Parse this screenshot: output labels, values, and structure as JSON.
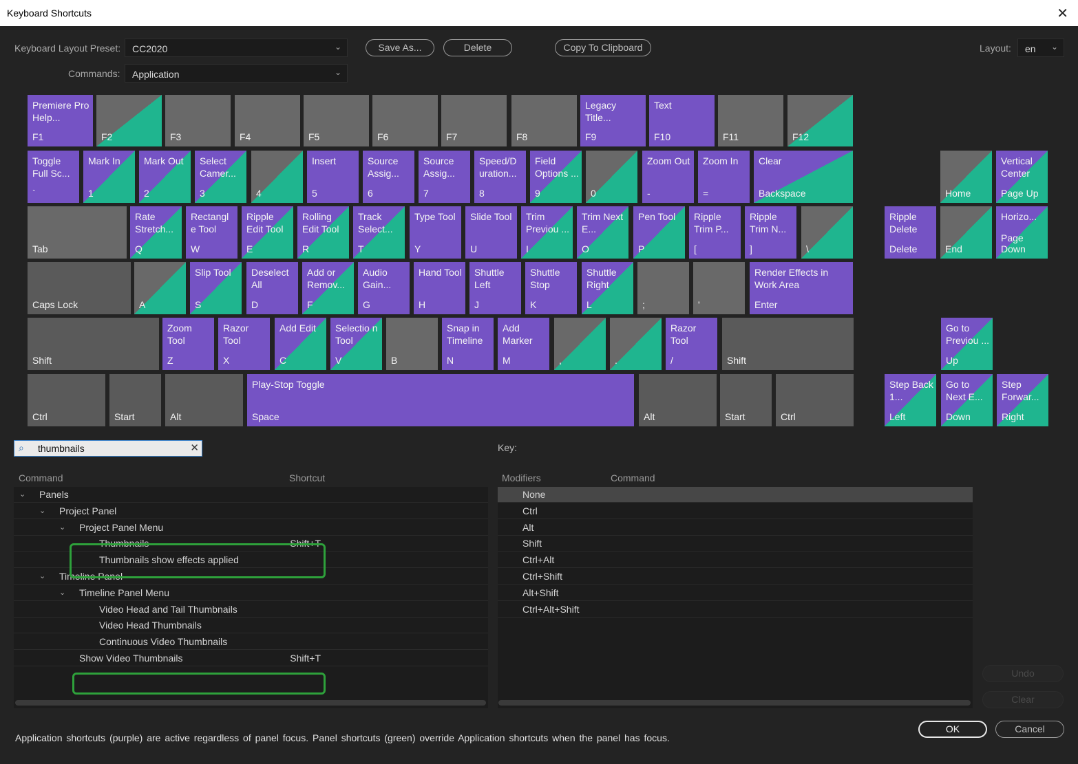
{
  "window": {
    "title": "Keyboard Shortcuts",
    "close": "✕"
  },
  "top": {
    "preset_label": "Keyboard Layout Preset:",
    "preset_value": "CC2020",
    "commands_label": "Commands:",
    "commands_value": "Application",
    "save_as": "Save As...",
    "delete": "Delete",
    "copy": "Copy To Clipboard",
    "layout_label": "Layout:",
    "layout_value": "en"
  },
  "keyboard": {
    "keys": [
      {
        "id": "f1",
        "label": "F1",
        "cmd": "Premiere Pro Help...",
        "style": "app"
      },
      {
        "id": "f2",
        "label": "F2",
        "cmd": "",
        "style": "graypanel"
      },
      {
        "id": "f3",
        "label": "F3",
        "cmd": "",
        "style": "plain"
      },
      {
        "id": "f4",
        "label": "F4",
        "cmd": "",
        "style": "plain"
      },
      {
        "id": "f5",
        "label": "F5",
        "cmd": "",
        "style": "plain"
      },
      {
        "id": "f6",
        "label": "F6",
        "cmd": "",
        "style": "plain"
      },
      {
        "id": "f7",
        "label": "F7",
        "cmd": "",
        "style": "plain"
      },
      {
        "id": "f8",
        "label": "F8",
        "cmd": "",
        "style": "plain"
      },
      {
        "id": "f9",
        "label": "F9",
        "cmd": "Legacy Title...",
        "style": "app"
      },
      {
        "id": "f10",
        "label": "F10",
        "cmd": "Text",
        "style": "app"
      },
      {
        "id": "f11",
        "label": "F11",
        "cmd": "",
        "style": "plain"
      },
      {
        "id": "f12",
        "label": "F12",
        "cmd": "",
        "style": "graypanel"
      },
      {
        "id": "tilde",
        "label": "`",
        "cmd": "Toggle Full Sc...",
        "style": "app"
      },
      {
        "id": "k1",
        "label": "1",
        "cmd": "Mark In",
        "style": "both"
      },
      {
        "id": "k2",
        "label": "2",
        "cmd": "Mark Out",
        "style": "both"
      },
      {
        "id": "k3",
        "label": "3",
        "cmd": "Select Camer...",
        "style": "both"
      },
      {
        "id": "k4",
        "label": "4",
        "cmd": "",
        "style": "graypanel"
      },
      {
        "id": "k5",
        "label": "5",
        "cmd": "Insert",
        "style": "app"
      },
      {
        "id": "k6",
        "label": "6",
        "cmd": "Source Assig...",
        "style": "app"
      },
      {
        "id": "k7",
        "label": "7",
        "cmd": "Source Assig...",
        "style": "app"
      },
      {
        "id": "k8",
        "label": "8",
        "cmd": "Speed/D uration...",
        "style": "app"
      },
      {
        "id": "k9",
        "label": "9",
        "cmd": "Field Options ...",
        "style": "both"
      },
      {
        "id": "k0",
        "label": "0",
        "cmd": "",
        "style": "graypanel"
      },
      {
        "id": "kminus",
        "label": "-",
        "cmd": "Zoom Out",
        "style": "app"
      },
      {
        "id": "kequal",
        "label": "=",
        "cmd": "Zoom In",
        "style": "app"
      },
      {
        "id": "backspace",
        "label": "Backspace",
        "cmd": "Clear",
        "style": "both"
      },
      {
        "id": "home",
        "label": "Home",
        "cmd": "",
        "style": "graypanel"
      },
      {
        "id": "pageup",
        "label": "Page Up",
        "cmd": "Vertical Center",
        "style": "both"
      },
      {
        "id": "tab",
        "label": "Tab",
        "cmd": "",
        "style": "plain"
      },
      {
        "id": "q",
        "label": "Q",
        "cmd": "Rate Stretch...",
        "style": "both"
      },
      {
        "id": "w",
        "label": "W",
        "cmd": "Rectangl e Tool",
        "style": "app"
      },
      {
        "id": "e",
        "label": "E",
        "cmd": "Ripple Edit Tool",
        "style": "both"
      },
      {
        "id": "r",
        "label": "R",
        "cmd": "Rolling Edit Tool",
        "style": "both"
      },
      {
        "id": "t",
        "label": "T",
        "cmd": "Track Select...",
        "style": "both"
      },
      {
        "id": "y",
        "label": "Y",
        "cmd": "Type Tool",
        "style": "app"
      },
      {
        "id": "u",
        "label": "U",
        "cmd": "Slide Tool",
        "style": "app"
      },
      {
        "id": "i",
        "label": "I",
        "cmd": "Trim Previou ...",
        "style": "both"
      },
      {
        "id": "o",
        "label": "O",
        "cmd": "Trim Next E...",
        "style": "both"
      },
      {
        "id": "p",
        "label": "P",
        "cmd": "Pen Tool",
        "style": "both"
      },
      {
        "id": "lbracket",
        "label": "[",
        "cmd": "Ripple Trim P...",
        "style": "app"
      },
      {
        "id": "rbracket",
        "label": "]",
        "cmd": "Ripple Trim N...",
        "style": "app"
      },
      {
        "id": "backslash",
        "label": "\\",
        "cmd": "",
        "style": "graypanel"
      },
      {
        "id": "delete",
        "label": "Delete",
        "cmd": "Ripple Delete",
        "style": "app"
      },
      {
        "id": "end",
        "label": "End",
        "cmd": "",
        "style": "graypanel"
      },
      {
        "id": "pagedown",
        "label": "Page Down",
        "cmd": "Horizo...",
        "style": "both"
      },
      {
        "id": "capslock",
        "label": "Caps Lock",
        "cmd": "",
        "style": "plain-dark"
      },
      {
        "id": "a",
        "label": "A",
        "cmd": "",
        "style": "graypanel"
      },
      {
        "id": "s",
        "label": "S",
        "cmd": "Slip Tool",
        "style": "both"
      },
      {
        "id": "d",
        "label": "D",
        "cmd": "Deselect All",
        "style": "app"
      },
      {
        "id": "f",
        "label": "F",
        "cmd": "Add or Remov...",
        "style": "both"
      },
      {
        "id": "g",
        "label": "G",
        "cmd": "Audio Gain...",
        "style": "app"
      },
      {
        "id": "h",
        "label": "H",
        "cmd": "Hand Tool",
        "style": "app"
      },
      {
        "id": "j",
        "label": "J",
        "cmd": "Shuttle Left",
        "style": "app"
      },
      {
        "id": "k",
        "label": "K",
        "cmd": "Shuttle Stop",
        "style": "app"
      },
      {
        "id": "l",
        "label": "L",
        "cmd": "Shuttle Right",
        "style": "both"
      },
      {
        "id": "semicolon",
        "label": ";",
        "cmd": "",
        "style": "plain"
      },
      {
        "id": "quote",
        "label": "'",
        "cmd": "",
        "style": "plain"
      },
      {
        "id": "enter",
        "label": "Enter",
        "cmd": "Render Effects in Work Area",
        "style": "app"
      },
      {
        "id": "lshift",
        "label": "Shift",
        "cmd": "",
        "style": "plain-dark"
      },
      {
        "id": "z",
        "label": "Z",
        "cmd": "Zoom Tool",
        "style": "app"
      },
      {
        "id": "x",
        "label": "X",
        "cmd": "Razor Tool",
        "style": "app"
      },
      {
        "id": "c",
        "label": "C",
        "cmd": "Add Edit",
        "style": "both"
      },
      {
        "id": "v",
        "label": "V",
        "cmd": "Selectio n Tool",
        "style": "both"
      },
      {
        "id": "b",
        "label": "B",
        "cmd": "",
        "style": "plain"
      },
      {
        "id": "n",
        "label": "N",
        "cmd": "Snap in Timeline",
        "style": "app"
      },
      {
        "id": "m",
        "label": "M",
        "cmd": "Add Marker",
        "style": "app"
      },
      {
        "id": "comma",
        "label": ",",
        "cmd": "",
        "style": "graypanel"
      },
      {
        "id": "period",
        "label": ".",
        "cmd": "",
        "style": "graypanel"
      },
      {
        "id": "slash",
        "label": "/",
        "cmd": "Razor Tool",
        "style": "app"
      },
      {
        "id": "rshift",
        "label": "Shift",
        "cmd": "",
        "style": "plain-dark"
      },
      {
        "id": "up",
        "label": "Up",
        "cmd": "Go to Previou ...",
        "style": "both"
      },
      {
        "id": "lctrl",
        "label": "Ctrl",
        "cmd": "",
        "style": "plain-dark"
      },
      {
        "id": "lstart",
        "label": "Start",
        "cmd": "",
        "style": "plain-dark"
      },
      {
        "id": "lalt",
        "label": "Alt",
        "cmd": "",
        "style": "plain-dark"
      },
      {
        "id": "space",
        "label": "Space",
        "cmd": "Play-Stop Toggle",
        "style": "app"
      },
      {
        "id": "ralt",
        "label": "Alt",
        "cmd": "",
        "style": "plain-dark"
      },
      {
        "id": "rstart",
        "label": "Start",
        "cmd": "",
        "style": "plain-dark"
      },
      {
        "id": "rctrl",
        "label": "Ctrl",
        "cmd": "",
        "style": "plain-dark"
      },
      {
        "id": "left",
        "label": "Left",
        "cmd": "Step Back 1...",
        "style": "both"
      },
      {
        "id": "down",
        "label": "Down",
        "cmd": "Go to Next E...",
        "style": "both"
      },
      {
        "id": "right",
        "label": "Right",
        "cmd": "Step Forwar...",
        "style": "both"
      }
    ]
  },
  "search": {
    "value": "thumbnails"
  },
  "command_list": {
    "col_command": "Command",
    "col_shortcut": "Shortcut",
    "rows": [
      {
        "indent": 0,
        "chev": true,
        "name": "Panels",
        "shortcut": ""
      },
      {
        "indent": 1,
        "chev": true,
        "name": "Project Panel",
        "shortcut": ""
      },
      {
        "indent": 2,
        "chev": true,
        "name": "Project Panel Menu",
        "shortcut": ""
      },
      {
        "indent": 3,
        "chev": false,
        "name": "Thumbnails",
        "shortcut": "Shift+T"
      },
      {
        "indent": 3,
        "chev": false,
        "name": "Thumbnails show effects applied",
        "shortcut": ""
      },
      {
        "indent": 1,
        "chev": true,
        "name": "Timeline Panel",
        "shortcut": ""
      },
      {
        "indent": 2,
        "chev": true,
        "name": "Timeline Panel Menu",
        "shortcut": ""
      },
      {
        "indent": 3,
        "chev": false,
        "name": "Video Head and Tail Thumbnails",
        "shortcut": ""
      },
      {
        "indent": 3,
        "chev": false,
        "name": "Video Head Thumbnails",
        "shortcut": ""
      },
      {
        "indent": 3,
        "chev": false,
        "name": "Continuous Video Thumbnails",
        "shortcut": ""
      },
      {
        "indent": 2,
        "chev": false,
        "name": "Show Video Thumbnails",
        "shortcut": "Shift+T"
      }
    ]
  },
  "key_panel": {
    "key_label": "Key:",
    "col_modifiers": "Modifiers",
    "col_command": "Command",
    "rows": [
      "None",
      "Ctrl",
      "Alt",
      "Shift",
      "Ctrl+Alt",
      "Ctrl+Shift",
      "Alt+Shift",
      "Ctrl+Alt+Shift"
    ]
  },
  "buttons": {
    "undo": "Undo",
    "clear": "Clear",
    "ok": "OK",
    "cancel": "Cancel"
  },
  "footer": "Application shortcuts (purple) are active regardless of panel focus. Panel shortcuts (green) override Application shortcuts when the panel has focus.",
  "colors": {
    "app": "#7553c4",
    "panel": "#1fb58f",
    "highlight": "#2ea13b"
  }
}
